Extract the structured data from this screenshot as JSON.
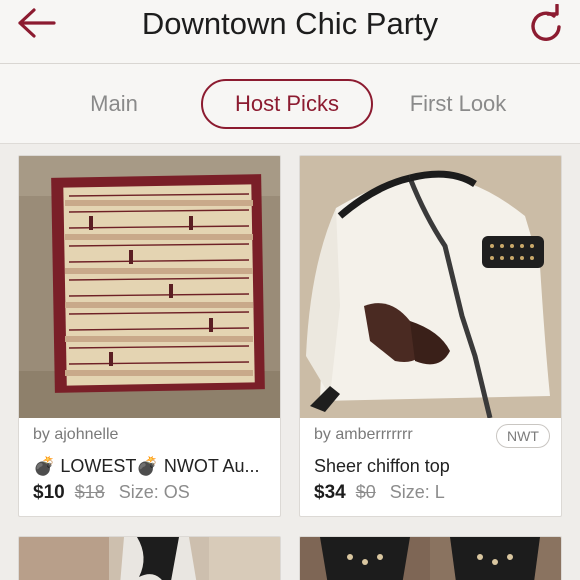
{
  "header": {
    "title": "Downtown Chic Party"
  },
  "tabs": [
    {
      "label": "Main"
    },
    {
      "label": "Host Picks"
    },
    {
      "label": "First Look"
    }
  ],
  "listings": [
    {
      "seller": "by ajohnelle",
      "title": "💣 LOWEST💣 NWOT Au...",
      "price": "$10",
      "original_price": "$18",
      "size": "Size: OS"
    },
    {
      "seller": "by amberrrrrrr",
      "badge": "NWT",
      "title": "Sheer chiffon top",
      "price": "$34",
      "original_price": "$0",
      "size": "Size: L"
    }
  ],
  "colors": {
    "accent": "#8c1b30",
    "background": "#efedea"
  },
  "icons": {
    "back": "back-arrow-icon",
    "refresh": "refresh-icon"
  }
}
